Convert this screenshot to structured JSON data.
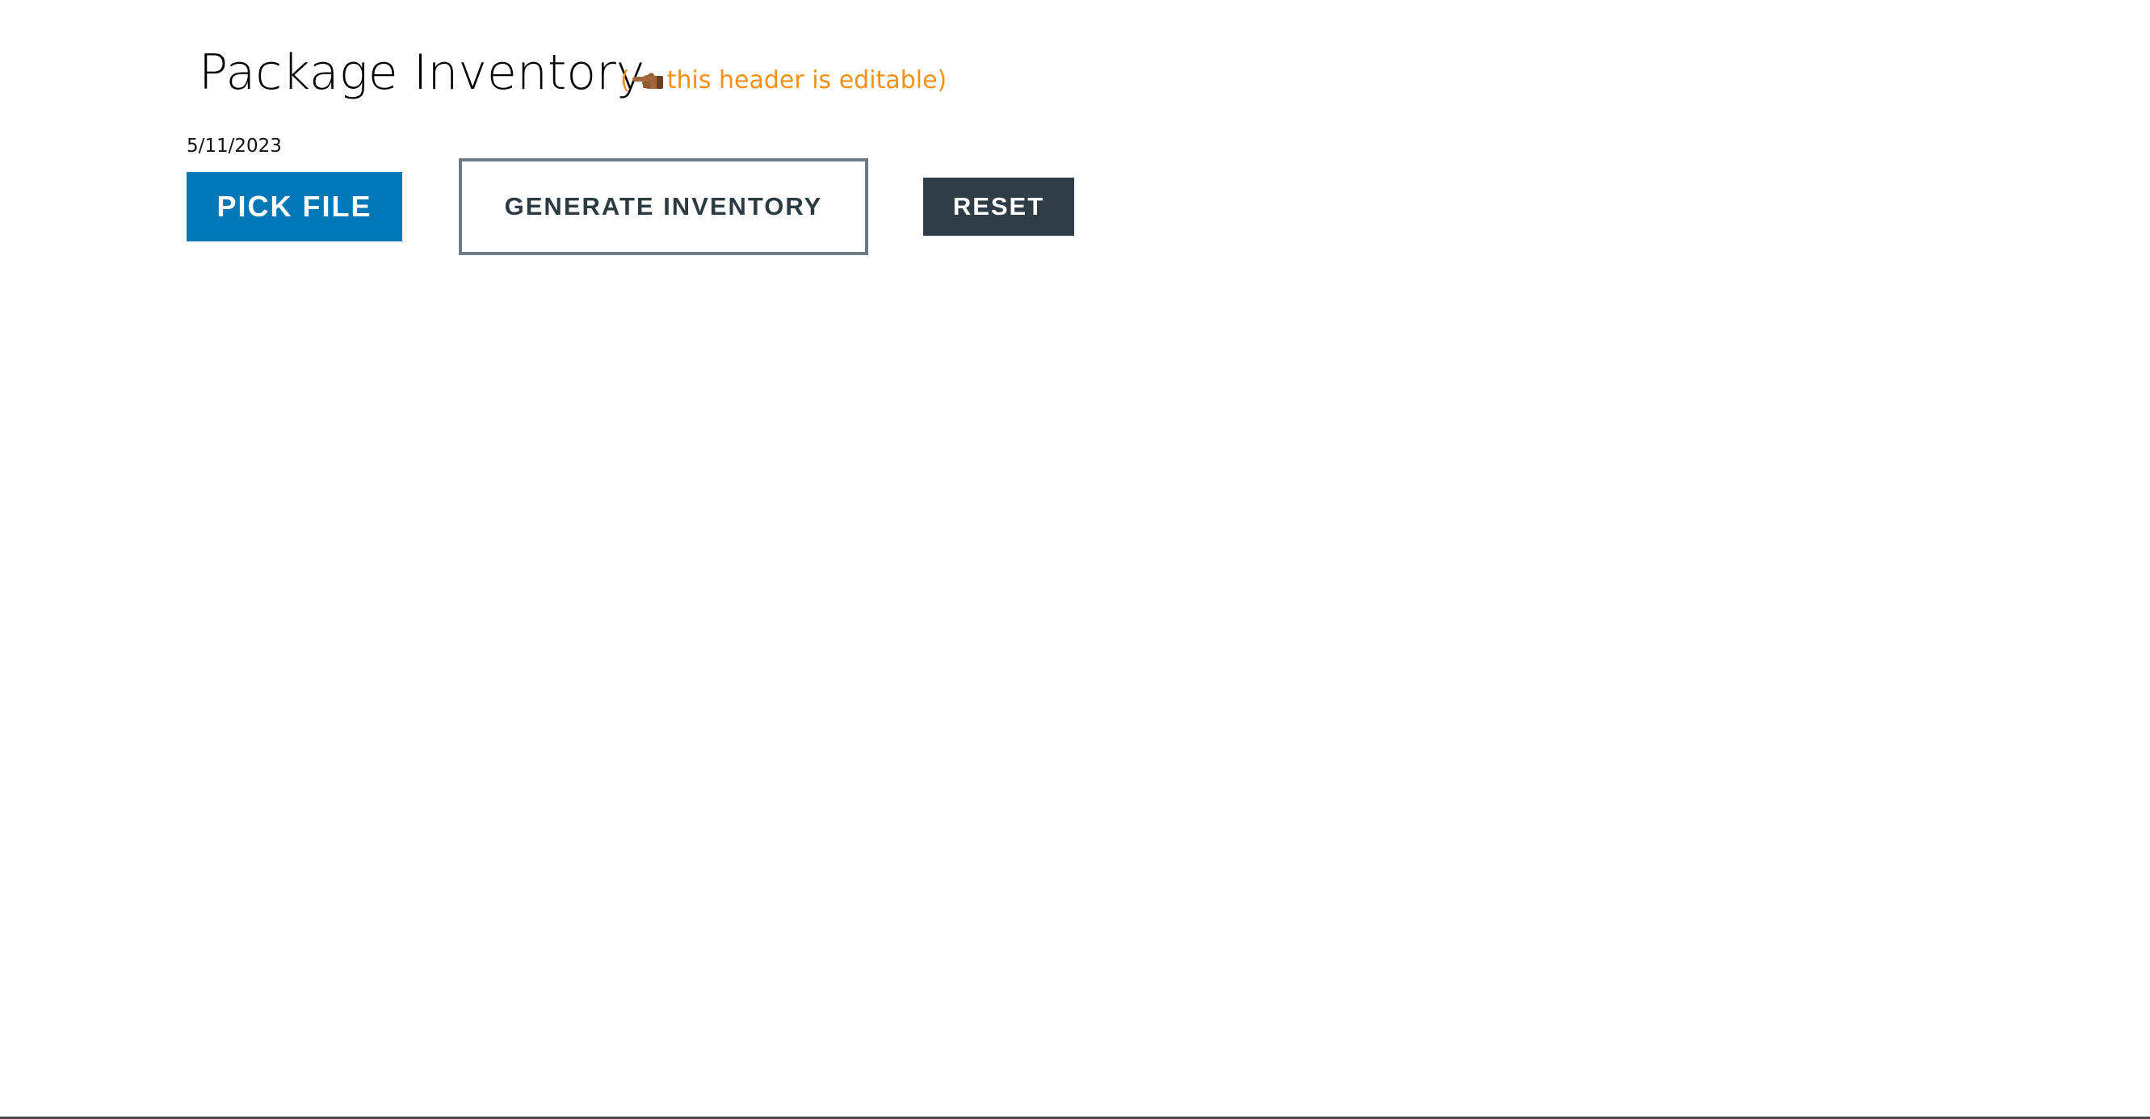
{
  "header": {
    "title": "Package Inventory",
    "hint_open": "(",
    "hint_text": " this header is editable)",
    "hint_icon": "pointing-left-hand-icon"
  },
  "date": "5/11/2023",
  "buttons": {
    "pick_file": "PICK FILE",
    "generate_inventory": "GENERATE INVENTORY",
    "reset": "RESET"
  },
  "colors": {
    "accent_blue": "#0078b8",
    "hint_orange": "#f39015",
    "dark_slate": "#2f3e46",
    "outline_gray": "#6c7b86"
  }
}
